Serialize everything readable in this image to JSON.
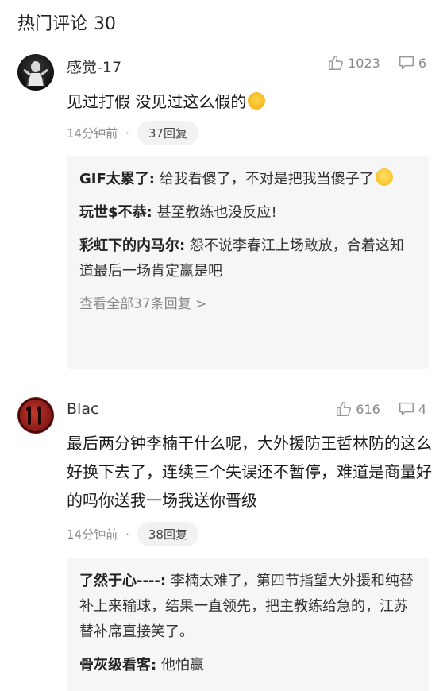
{
  "section": {
    "title": "热门评论",
    "count": "30"
  },
  "comments": [
    {
      "username": "感觉-17",
      "likes": "1023",
      "comments_count": "6",
      "text": "见过打假 没见过这么假的",
      "emoji": "sweat-smile-emoji",
      "time": "14分钟前",
      "dot": "·",
      "reply_count_label": "37回复",
      "replies": [
        {
          "name": "GIF太累了:",
          "text": " 给我看傻了，不对是把我当傻子了",
          "emoji": "smile-emoji"
        },
        {
          "name": "玩世$不恭:",
          "text": " 甚至教练也没反应!"
        },
        {
          "name": "彩虹下的内马尔:",
          "text": " 怨不说李春江上场敢放，合着这知道最后一场肯定赢是吧"
        }
      ],
      "view_all": "查看全部37条回复 >"
    },
    {
      "username": "Blac",
      "likes": "616",
      "comments_count": "4",
      "text": "最后两分钟李楠干什么呢，大外援防王哲林防的这么好换下去了，连续三个失误还不暂停，难道是商量好的吗你送我一场我送你晋级",
      "time": "14分钟前",
      "dot": "·",
      "reply_count_label": "38回复",
      "replies": [
        {
          "name": "了然于心----:",
          "text": " 李楠太难了，第四节指望大外援和纯替补上来输球，结果一直领先，把主教练给急的，江苏替补席直接笑了。"
        },
        {
          "name": "骨灰级看客:",
          "text": " 他怕赢"
        }
      ]
    }
  ]
}
